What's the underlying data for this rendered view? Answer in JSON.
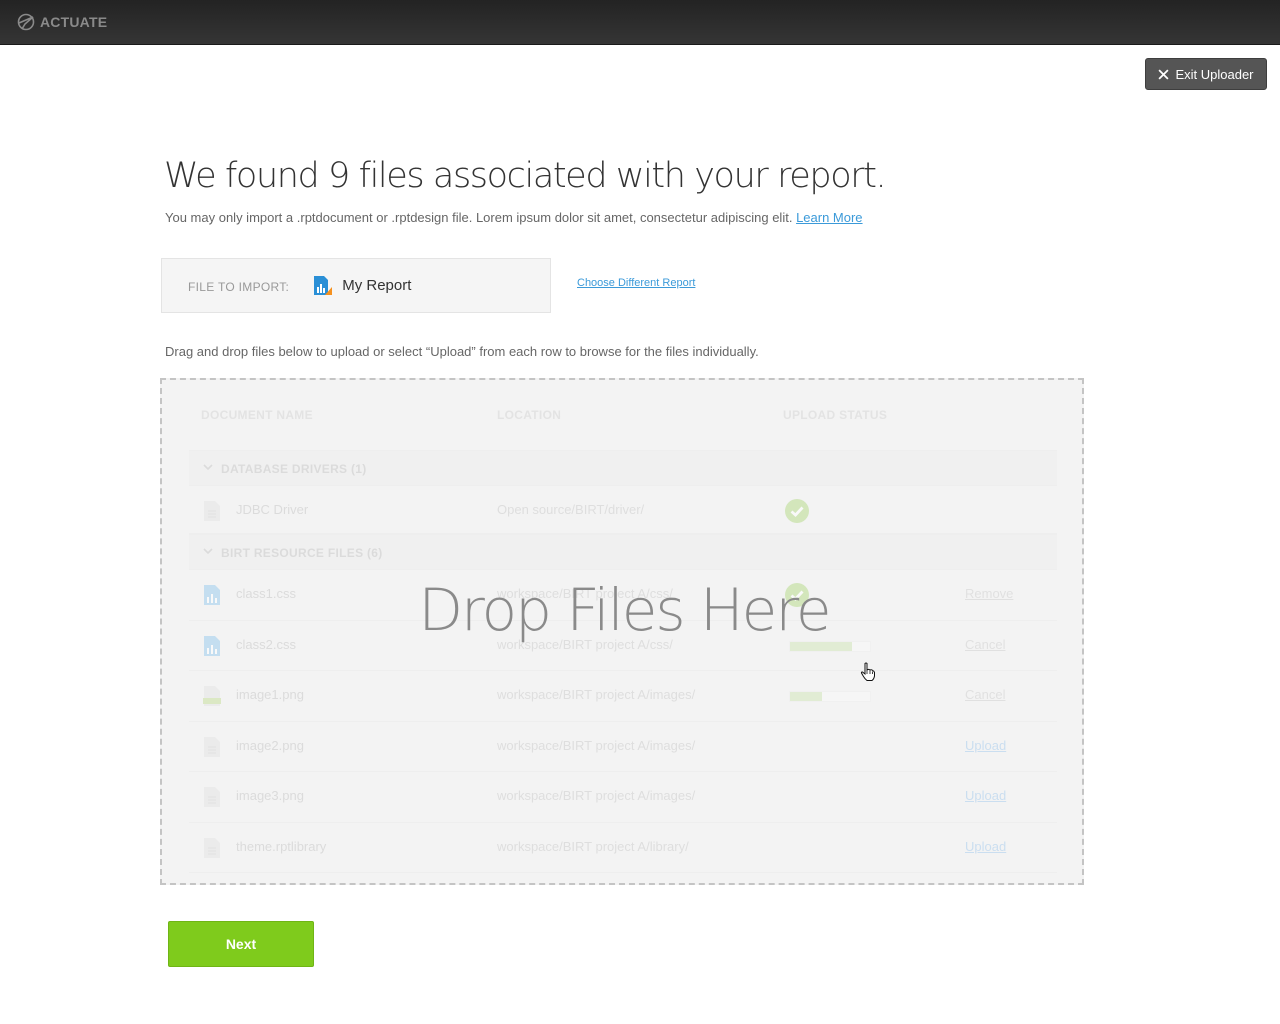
{
  "app": {
    "brand": "ACTUATE"
  },
  "header": {
    "exit_label": "Exit Uploader"
  },
  "main": {
    "title": "We found 9 files associated with your report.",
    "subtitle": "You may only import a .rptdocument or .rptdesign file. Lorem ipsum dolor sit amet, consectetur adipiscing elit.",
    "learn_more": "Learn More",
    "import": {
      "label": "FILE TO IMPORT:",
      "report_name": "My Report",
      "choose_link": "Choose Different Report"
    },
    "instructions": "Drag and drop files below to upload or select “Upload” from each row to browse for the files individually.",
    "dropzone_text": "Drop Files Here",
    "next_label": "Next"
  },
  "table": {
    "columns": [
      "DOCUMENT NAME",
      "LOCATION",
      "UPLOAD STATUS"
    ],
    "groups": [
      {
        "label": "DATABASE DRIVERS (1)",
        "rows": [
          {
            "name": "JDBC Driver",
            "location": "Open source/BIRT/driver/",
            "status": "complete",
            "icon": "document-icon",
            "action": ""
          }
        ]
      },
      {
        "label": "BIRT RESOURCE FILES (6)",
        "rows": [
          {
            "name": "class1.css",
            "location": "workspace/BIRT project A/css/",
            "status": "complete",
            "icon": "report-file-icon",
            "action": "Remove"
          },
          {
            "name": "class2.css",
            "location": "workspace/BIRT project A/css/",
            "status": "uploading",
            "progress": 0.77,
            "icon": "report-file-icon",
            "action": "Cancel"
          },
          {
            "name": "image1.png",
            "location": "workspace/BIRT project A/images/",
            "status": "uploading",
            "progress": 0.4,
            "icon": "html-file-icon",
            "action": "Cancel"
          },
          {
            "name": "image2.png",
            "location": "workspace/BIRT project A/images/",
            "status": "pending",
            "icon": "document-icon",
            "action": "Upload"
          },
          {
            "name": "image3.png",
            "location": "workspace/BIRT project A/images/",
            "status": "pending",
            "icon": "document-icon",
            "action": "Upload"
          },
          {
            "name": "theme.rptlibrary",
            "location": "workspace/BIRT project A/library/",
            "status": "pending",
            "icon": "document-icon",
            "action": "Upload"
          }
        ]
      }
    ]
  },
  "colors": {
    "accent_green": "#7fcb1c",
    "link_blue": "#3b9ad9",
    "topbar": "#2b2b2b"
  }
}
